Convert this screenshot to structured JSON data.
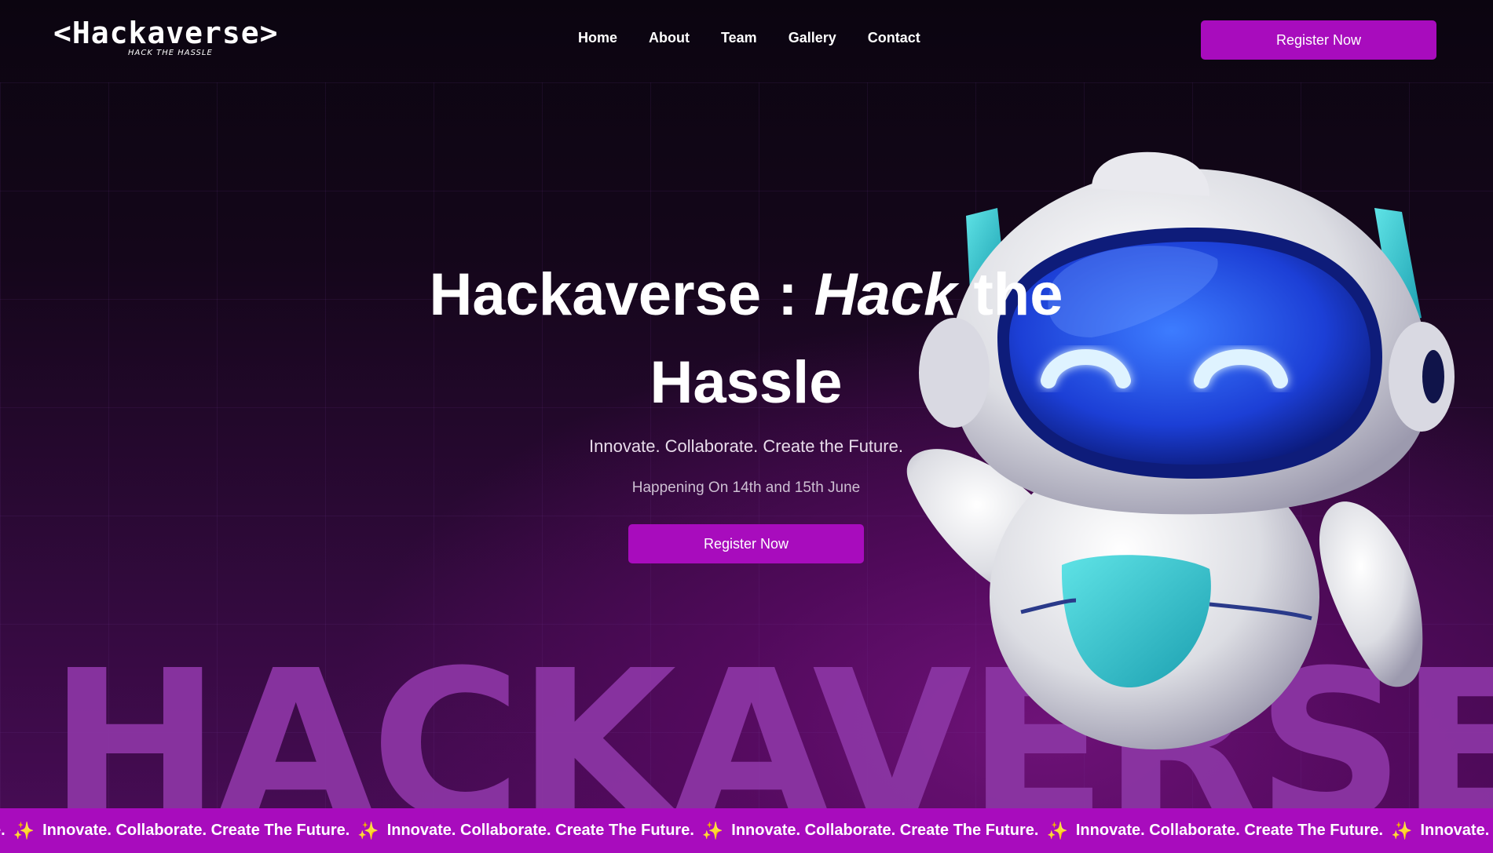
{
  "logo": {
    "main": "<Hackaverse>",
    "sub": "HACK THE HASSLE"
  },
  "nav": {
    "items": [
      "Home",
      "About",
      "Team",
      "Gallery",
      "Contact"
    ]
  },
  "header": {
    "register_label": "Register Now"
  },
  "hero": {
    "title_plain": "Hackaverse : ",
    "title_italic": "Hack",
    "title_rest_1": " the",
    "title_line2": "Hassle",
    "tagline": "Innovate. Collaborate. Create the Future.",
    "date": "Happening On 14th and 15th June",
    "register_label": "Register Now",
    "watermark": "HACKAVERSE"
  },
  "ticker": {
    "lead_text": "e.",
    "item_text": "Innovate. Collaborate. Create The Future.",
    "tail_text": "Innovate. Collaborate. Cr",
    "icon": "sparkles-icon"
  },
  "colors": {
    "accent": "#a80cbd",
    "background": "#0c0410",
    "robot_visor": "#2b6bff",
    "robot_teal": "#2dc6cc"
  }
}
